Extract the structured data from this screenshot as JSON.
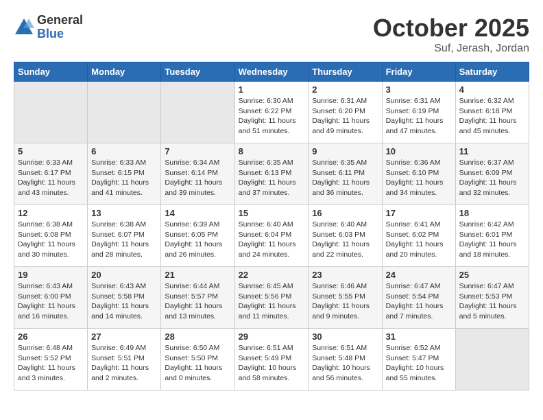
{
  "header": {
    "logo_general": "General",
    "logo_blue": "Blue",
    "month_title": "October 2025",
    "location": "Suf, Jerash, Jordan"
  },
  "days_of_week": [
    "Sunday",
    "Monday",
    "Tuesday",
    "Wednesday",
    "Thursday",
    "Friday",
    "Saturday"
  ],
  "weeks": [
    [
      {
        "day": "",
        "info": ""
      },
      {
        "day": "",
        "info": ""
      },
      {
        "day": "",
        "info": ""
      },
      {
        "day": "1",
        "info": "Sunrise: 6:30 AM\nSunset: 6:22 PM\nDaylight: 11 hours\nand 51 minutes."
      },
      {
        "day": "2",
        "info": "Sunrise: 6:31 AM\nSunset: 6:20 PM\nDaylight: 11 hours\nand 49 minutes."
      },
      {
        "day": "3",
        "info": "Sunrise: 6:31 AM\nSunset: 6:19 PM\nDaylight: 11 hours\nand 47 minutes."
      },
      {
        "day": "4",
        "info": "Sunrise: 6:32 AM\nSunset: 6:18 PM\nDaylight: 11 hours\nand 45 minutes."
      }
    ],
    [
      {
        "day": "5",
        "info": "Sunrise: 6:33 AM\nSunset: 6:17 PM\nDaylight: 11 hours\nand 43 minutes."
      },
      {
        "day": "6",
        "info": "Sunrise: 6:33 AM\nSunset: 6:15 PM\nDaylight: 11 hours\nand 41 minutes."
      },
      {
        "day": "7",
        "info": "Sunrise: 6:34 AM\nSunset: 6:14 PM\nDaylight: 11 hours\nand 39 minutes."
      },
      {
        "day": "8",
        "info": "Sunrise: 6:35 AM\nSunset: 6:13 PM\nDaylight: 11 hours\nand 37 minutes."
      },
      {
        "day": "9",
        "info": "Sunrise: 6:35 AM\nSunset: 6:11 PM\nDaylight: 11 hours\nand 36 minutes."
      },
      {
        "day": "10",
        "info": "Sunrise: 6:36 AM\nSunset: 6:10 PM\nDaylight: 11 hours\nand 34 minutes."
      },
      {
        "day": "11",
        "info": "Sunrise: 6:37 AM\nSunset: 6:09 PM\nDaylight: 11 hours\nand 32 minutes."
      }
    ],
    [
      {
        "day": "12",
        "info": "Sunrise: 6:38 AM\nSunset: 6:08 PM\nDaylight: 11 hours\nand 30 minutes."
      },
      {
        "day": "13",
        "info": "Sunrise: 6:38 AM\nSunset: 6:07 PM\nDaylight: 11 hours\nand 28 minutes."
      },
      {
        "day": "14",
        "info": "Sunrise: 6:39 AM\nSunset: 6:05 PM\nDaylight: 11 hours\nand 26 minutes."
      },
      {
        "day": "15",
        "info": "Sunrise: 6:40 AM\nSunset: 6:04 PM\nDaylight: 11 hours\nand 24 minutes."
      },
      {
        "day": "16",
        "info": "Sunrise: 6:40 AM\nSunset: 6:03 PM\nDaylight: 11 hours\nand 22 minutes."
      },
      {
        "day": "17",
        "info": "Sunrise: 6:41 AM\nSunset: 6:02 PM\nDaylight: 11 hours\nand 20 minutes."
      },
      {
        "day": "18",
        "info": "Sunrise: 6:42 AM\nSunset: 6:01 PM\nDaylight: 11 hours\nand 18 minutes."
      }
    ],
    [
      {
        "day": "19",
        "info": "Sunrise: 6:43 AM\nSunset: 6:00 PM\nDaylight: 11 hours\nand 16 minutes."
      },
      {
        "day": "20",
        "info": "Sunrise: 6:43 AM\nSunset: 5:58 PM\nDaylight: 11 hours\nand 14 minutes."
      },
      {
        "day": "21",
        "info": "Sunrise: 6:44 AM\nSunset: 5:57 PM\nDaylight: 11 hours\nand 13 minutes."
      },
      {
        "day": "22",
        "info": "Sunrise: 6:45 AM\nSunset: 5:56 PM\nDaylight: 11 hours\nand 11 minutes."
      },
      {
        "day": "23",
        "info": "Sunrise: 6:46 AM\nSunset: 5:55 PM\nDaylight: 11 hours\nand 9 minutes."
      },
      {
        "day": "24",
        "info": "Sunrise: 6:47 AM\nSunset: 5:54 PM\nDaylight: 11 hours\nand 7 minutes."
      },
      {
        "day": "25",
        "info": "Sunrise: 6:47 AM\nSunset: 5:53 PM\nDaylight: 11 hours\nand 5 minutes."
      }
    ],
    [
      {
        "day": "26",
        "info": "Sunrise: 6:48 AM\nSunset: 5:52 PM\nDaylight: 11 hours\nand 3 minutes."
      },
      {
        "day": "27",
        "info": "Sunrise: 6:49 AM\nSunset: 5:51 PM\nDaylight: 11 hours\nand 2 minutes."
      },
      {
        "day": "28",
        "info": "Sunrise: 6:50 AM\nSunset: 5:50 PM\nDaylight: 11 hours\nand 0 minutes."
      },
      {
        "day": "29",
        "info": "Sunrise: 6:51 AM\nSunset: 5:49 PM\nDaylight: 10 hours\nand 58 minutes."
      },
      {
        "day": "30",
        "info": "Sunrise: 6:51 AM\nSunset: 5:48 PM\nDaylight: 10 hours\nand 56 minutes."
      },
      {
        "day": "31",
        "info": "Sunrise: 6:52 AM\nSunset: 5:47 PM\nDaylight: 10 hours\nand 55 minutes."
      },
      {
        "day": "",
        "info": ""
      }
    ]
  ]
}
